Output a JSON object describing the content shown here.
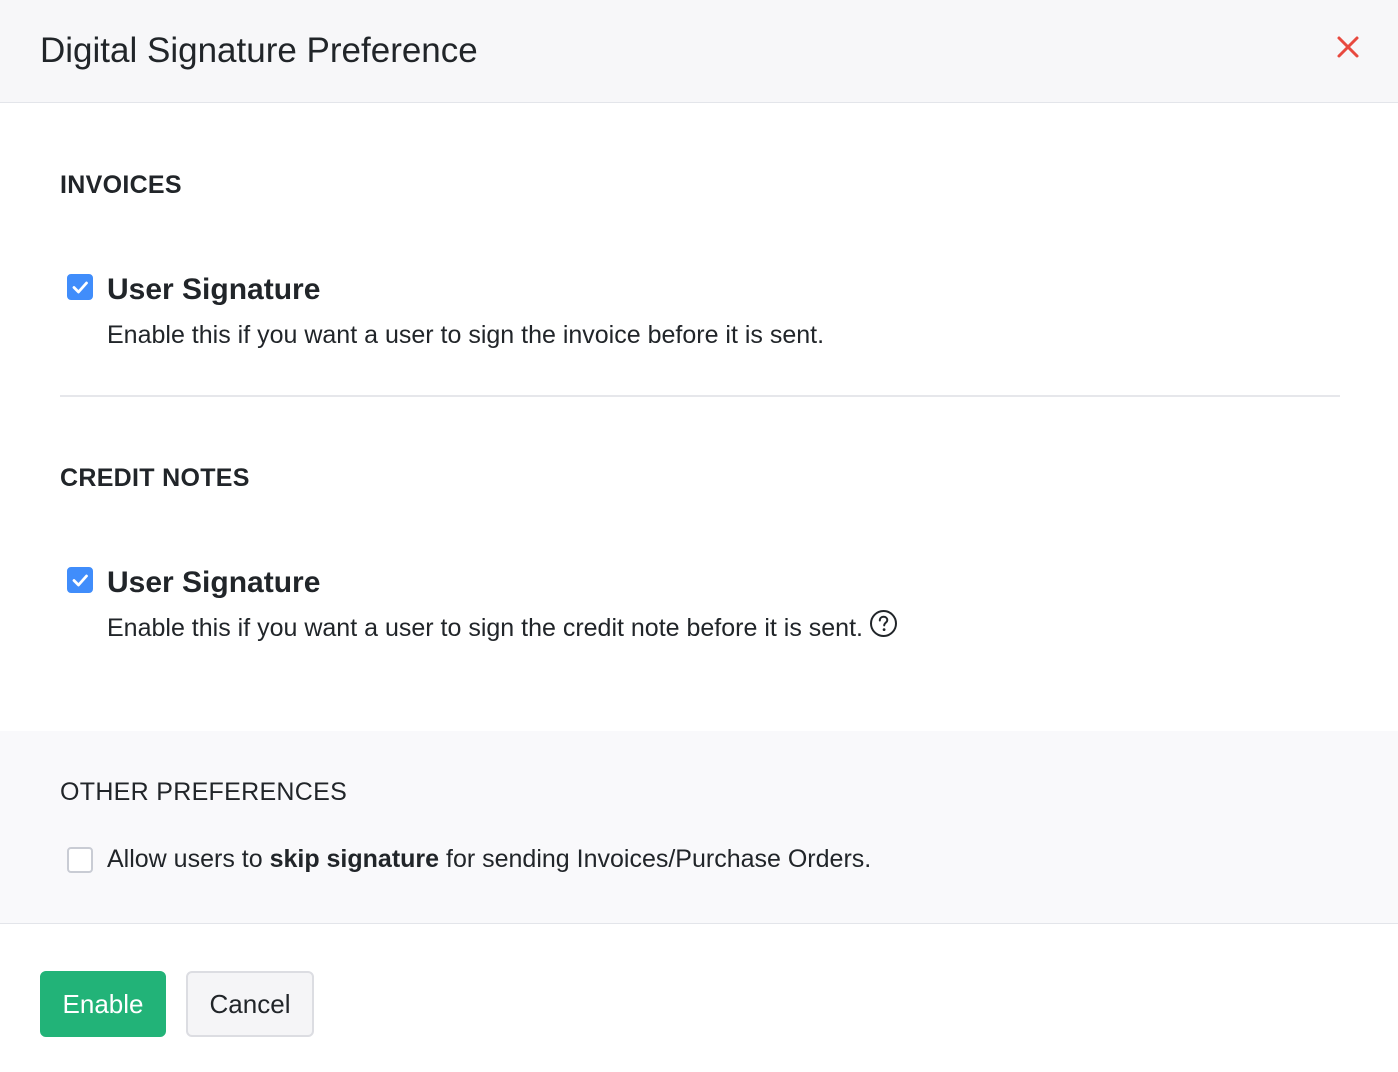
{
  "dialog": {
    "title": "Digital Signature Preference"
  },
  "invoices": {
    "section_title": "INVOICES",
    "option": {
      "label": "User Signature",
      "description": "Enable this if you want a user to sign the invoice before it is sent.",
      "checked": true
    }
  },
  "credit_notes": {
    "section_title": "CREDIT NOTES",
    "option": {
      "label": "User Signature",
      "description": "Enable this if you want a user to sign the credit note before it is sent.",
      "checked": true,
      "help_icon": "question-circle-icon"
    }
  },
  "other_preferences": {
    "section_title": "OTHER PREFERENCES",
    "skip_option": {
      "text_before": "Allow users to ",
      "text_bold": "skip signature",
      "text_after": " for sending Invoices/Purchase Orders.",
      "checked": false
    }
  },
  "footer": {
    "enable_label": "Enable",
    "cancel_label": "Cancel"
  },
  "colors": {
    "primary_green": "#22b378",
    "checkbox_blue": "#408dfb",
    "close_red": "#e8493f"
  }
}
